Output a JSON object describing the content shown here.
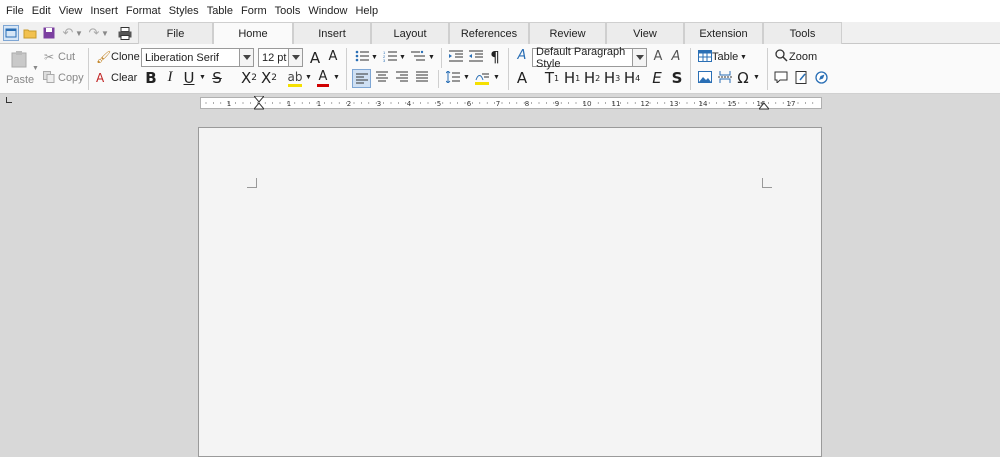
{
  "menubar": {
    "items": [
      "File",
      "Edit",
      "View",
      "Insert",
      "Format",
      "Styles",
      "Table",
      "Form",
      "Tools",
      "Window",
      "Help"
    ]
  },
  "tabs": [
    {
      "label": "File"
    },
    {
      "label": "Home"
    },
    {
      "label": "Insert"
    },
    {
      "label": "Layout"
    },
    {
      "label": "References"
    },
    {
      "label": "Review"
    },
    {
      "label": "View"
    },
    {
      "label": "Extension"
    },
    {
      "label": "Tools"
    }
  ],
  "active_tab": "Home",
  "clipboard": {
    "paste": "Paste",
    "cut": "Cut",
    "copy": "Copy",
    "clone": "Clone",
    "clear": "Clear"
  },
  "font": {
    "name": "Liberation Serif",
    "size": "12 pt"
  },
  "paragraph_style": "Default Paragraph Style",
  "insert": {
    "table": "Table",
    "zoom": "Zoom"
  },
  "ruler_labels": [
    "1",
    "1",
    "1",
    "2",
    "3",
    "4",
    "5",
    "6",
    "7",
    "8",
    "9",
    "10",
    "11",
    "12",
    "13",
    "14",
    "15",
    "16",
    "17",
    "18"
  ],
  "colors": {
    "accent": "#2a6fb5",
    "highlight": "#f5e000",
    "font_color": "#d00000"
  }
}
